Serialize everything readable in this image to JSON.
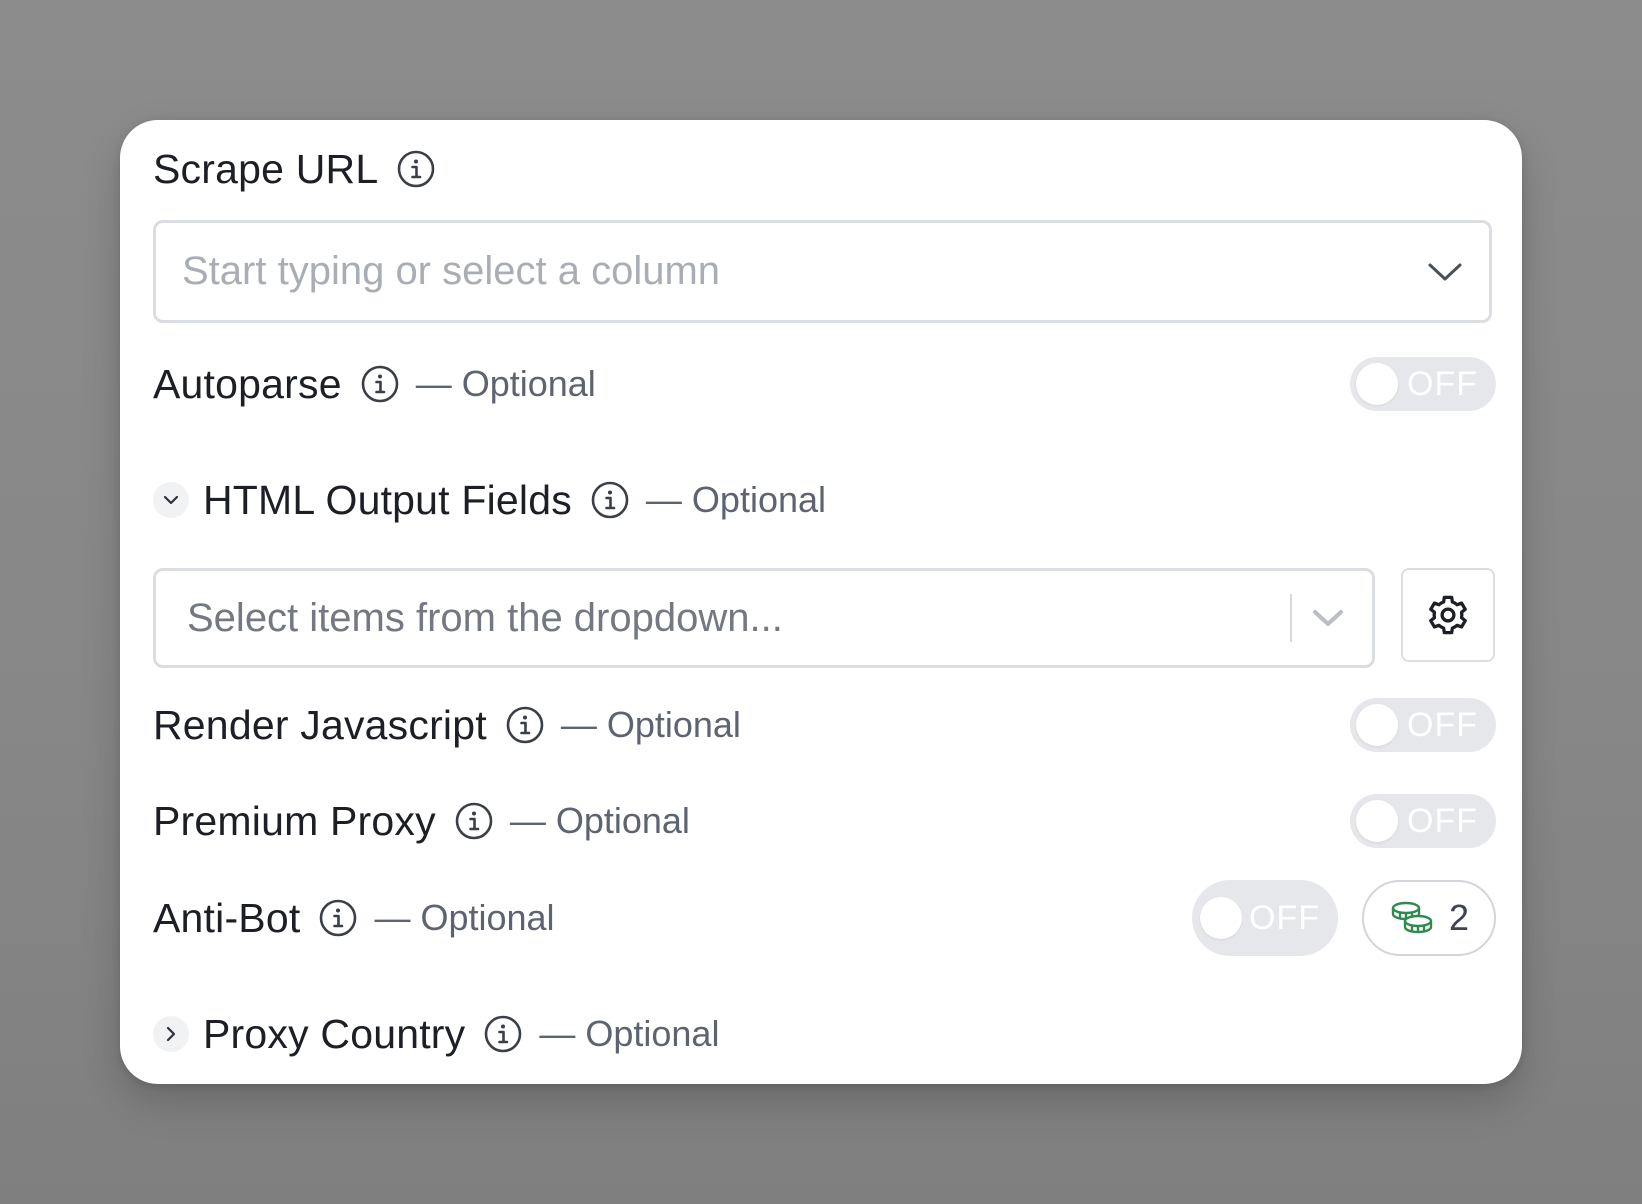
{
  "scrape_url": {
    "label": "Scrape URL",
    "placeholder": "Start typing or select a column"
  },
  "optional_suffix": "— Optional",
  "autoparse": {
    "label": "Autoparse",
    "state": "OFF"
  },
  "html_output_fields": {
    "label": "HTML Output Fields",
    "expanded": true,
    "placeholder": "Select items from the dropdown..."
  },
  "render_javascript": {
    "label": "Render Javascript",
    "state": "OFF"
  },
  "premium_proxy": {
    "label": "Premium Proxy",
    "state": "OFF"
  },
  "anti_bot": {
    "label": "Anti-Bot",
    "state": "OFF",
    "credit_cost": "2",
    "credit_icon": "coins-icon",
    "credit_icon_color": "#2f8a4d"
  },
  "proxy_country": {
    "label": "Proxy Country",
    "expanded": false
  },
  "colors": {
    "backdrop": "#888888",
    "card": "#ffffff",
    "toggle_off": "#e5e7eb",
    "border": "#dadde2"
  }
}
